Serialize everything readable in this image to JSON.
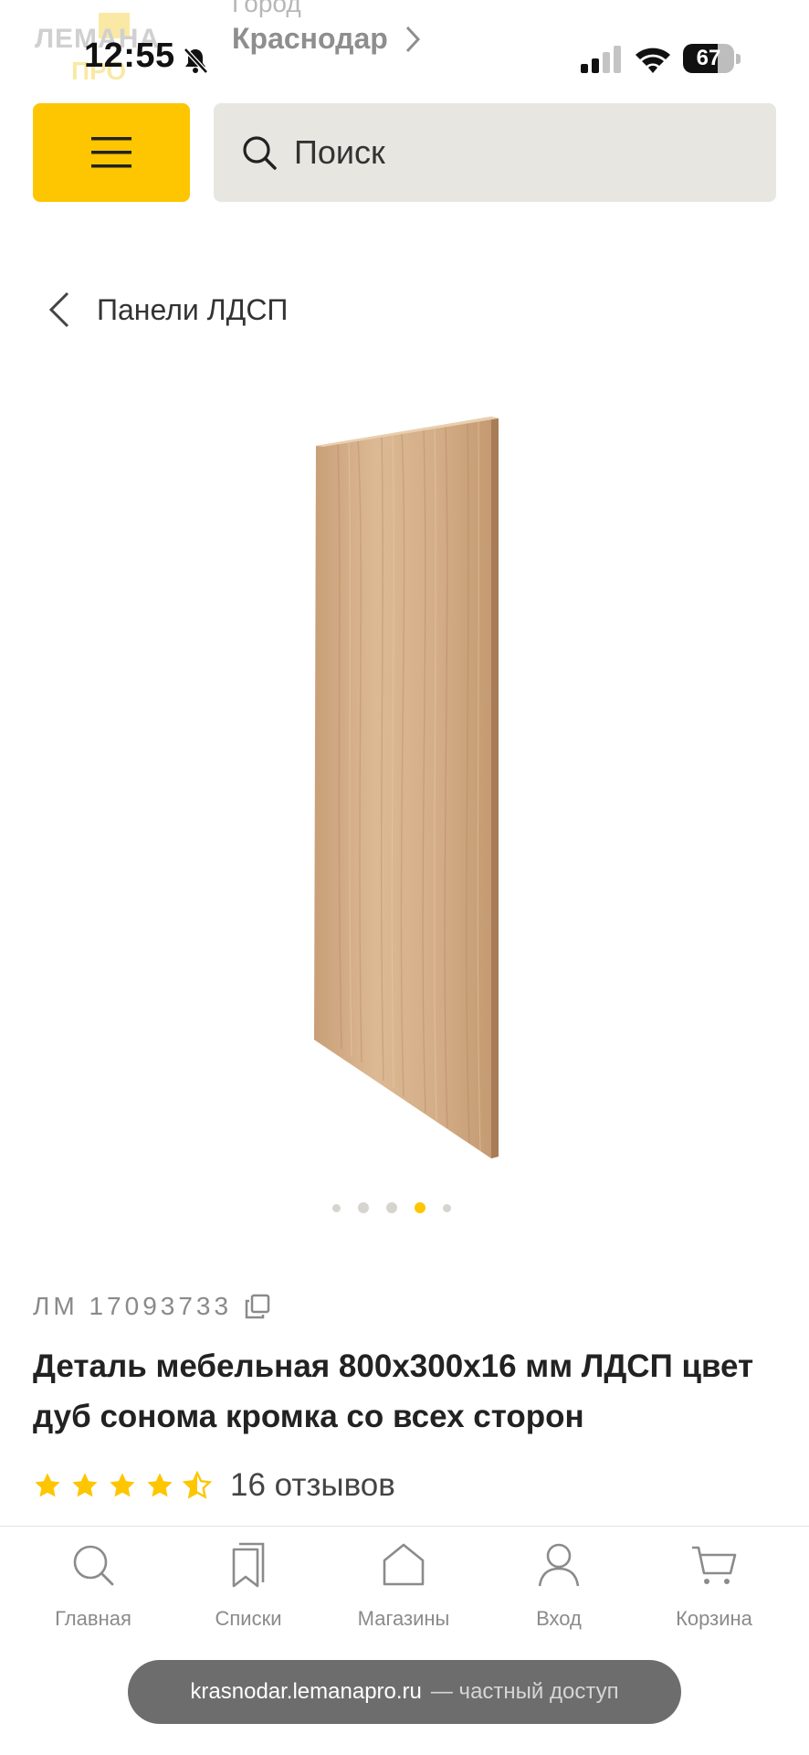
{
  "status_bar": {
    "time": "12:55",
    "battery": "67",
    "battery_level": 0.67
  },
  "header": {
    "logo_line1": "ЛЕМАНА",
    "logo_line2": "ПРО",
    "city_label": "Город",
    "city": "Краснодар"
  },
  "search": {
    "placeholder": "Поиск"
  },
  "breadcrumb": {
    "label": "Панели ЛДСП"
  },
  "carousel": {
    "total": 5,
    "active_index": 3
  },
  "product": {
    "sku": "ЛМ 17093733",
    "title": "Деталь мебельная 800х300х16 мм ЛДСП цвет дуб сонома кромка со всех сторон",
    "rating": 4.5,
    "rating_max": 5,
    "reviews": "16 отзывов"
  },
  "bottom_nav": {
    "items": [
      {
        "label": "Главная",
        "icon": "search-icon"
      },
      {
        "label": "Списки",
        "icon": "bookmark-icon"
      },
      {
        "label": "Магазины",
        "icon": "home-icon"
      },
      {
        "label": "Вход",
        "icon": "user-icon"
      },
      {
        "label": "Корзина",
        "icon": "cart-icon"
      }
    ]
  },
  "url_bar": {
    "domain": "krasnodar.lemanapro.ru",
    "note": "— частный доступ"
  },
  "colors": {
    "accent": "#fdc600",
    "search_bg": "#e7e6e1",
    "wood_light": "#d9b38c",
    "wood_dark": "#b68d66"
  }
}
